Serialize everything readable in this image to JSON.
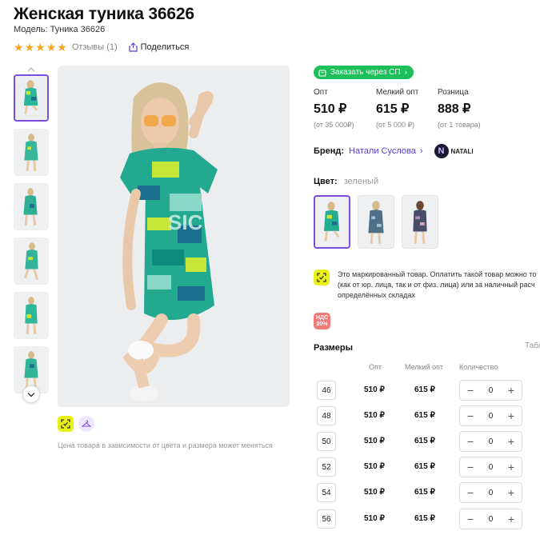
{
  "product": {
    "title": "Женская туника 36626",
    "model": "Модель: Туника 36626",
    "stars": 5,
    "reviews": "Отзывы (1)",
    "share": "Поделиться"
  },
  "gallery": {
    "note": "Цена товара в зависимости от цвета и размера может меняться"
  },
  "order_button": "Заказать через СП",
  "prices": [
    {
      "label": "Опт",
      "value": "510 ₽",
      "sub": "(от 35 000₽)"
    },
    {
      "label": "Мелкий опт",
      "value": "615 ₽",
      "sub": "(от 5 000 ₽)"
    },
    {
      "label": "Розница",
      "value": "888 ₽",
      "sub": "(от 1 товара)"
    }
  ],
  "brand": {
    "label": "Бренд:",
    "name": "Натали Суслова",
    "logo_text": "NATALI",
    "logo_letter": "N"
  },
  "color": {
    "label": "Цвет:",
    "value": "зеленый"
  },
  "marking": {
    "line1": "Это маркированный товар. Оплатить такой товар можно то",
    "line2": "(как от юр. лица, так и от физ. лица) или за наличный расч",
    "line3": "определённых складах"
  },
  "nds": {
    "line1": "НДС",
    "line2": "20%"
  },
  "sizes": {
    "title": "Размеры",
    "table_link": "Табл",
    "headers": {
      "opt": "Опт",
      "small_opt": "Мелкий опт",
      "qty": "Количество"
    },
    "rows": [
      {
        "size": "46",
        "opt": "510 ₽",
        "small_opt": "615 ₽",
        "qty": "0"
      },
      {
        "size": "48",
        "opt": "510 ₽",
        "small_opt": "615 ₽",
        "qty": "0"
      },
      {
        "size": "50",
        "opt": "510 ₽",
        "small_opt": "615 ₽",
        "qty": "0"
      },
      {
        "size": "52",
        "opt": "510 ₽",
        "small_opt": "615 ₽",
        "qty": "0"
      },
      {
        "size": "54",
        "opt": "510 ₽",
        "small_opt": "615 ₽",
        "qty": "0"
      },
      {
        "size": "56",
        "opt": "510 ₽",
        "small_opt": "615 ₽",
        "qty": "0"
      }
    ]
  },
  "colors": {
    "accent": "#7b4de0",
    "green": "#1dbf5b",
    "star": "#f5a623",
    "brand_link": "#5b3fd6",
    "marking_badge": "#e8f018"
  }
}
